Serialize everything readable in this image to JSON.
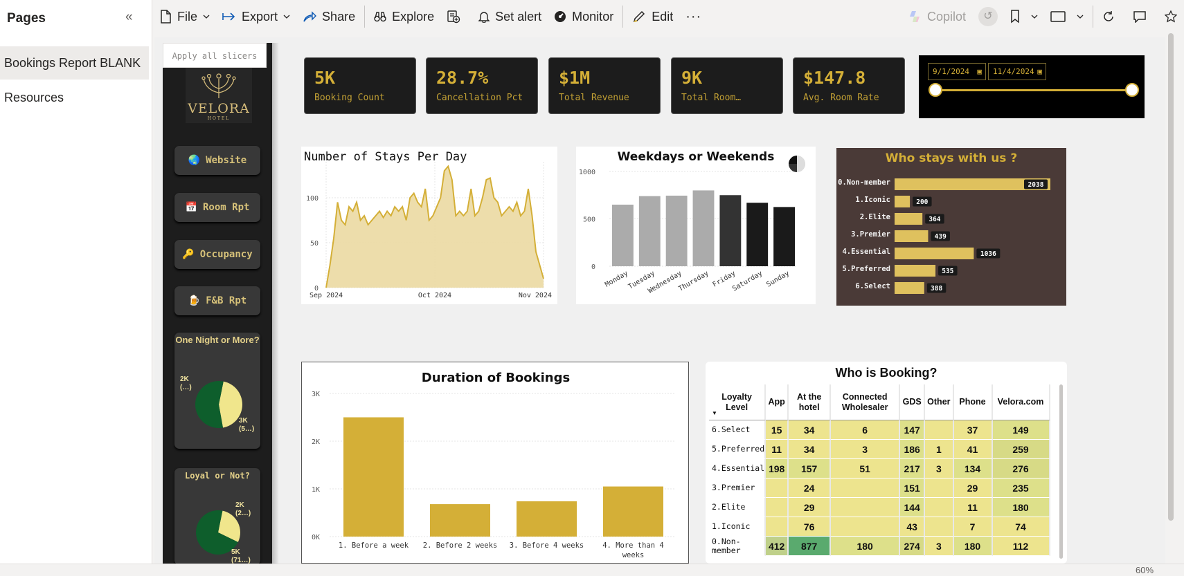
{
  "pages_pane": {
    "title": "Pages",
    "items": [
      {
        "label": "Bookings Report BLANK",
        "active": true
      },
      {
        "label": "Resources",
        "active": false
      }
    ]
  },
  "toolbar": {
    "file": "File",
    "export": "Export",
    "share": "Share",
    "explore": "Explore",
    "set_alert": "Set alert",
    "monitor": "Monitor",
    "edit": "Edit",
    "copilot": "Copilot"
  },
  "nav": {
    "apply_slicers": "Apply all slicers",
    "logo_word": "VELORA",
    "logo_sub": "HOTEL",
    "buttons": [
      {
        "icon": "🌏",
        "label": "Website"
      },
      {
        "icon": "📅",
        "label": "Room Rpt"
      },
      {
        "icon": "🔑",
        "label": "Occupancy"
      },
      {
        "icon": "🍺",
        "label": "F&B Rpt"
      }
    ],
    "one_night": {
      "title": "One Night or More?",
      "labels": [
        "2K (…)",
        "3K (5…)"
      ],
      "values": [
        0.44,
        0.56
      ]
    },
    "loyal": {
      "title": "Loyal or Not?",
      "labels": [
        "2K (2…)",
        "5K (71…)"
      ],
      "values": [
        0.29,
        0.71
      ]
    }
  },
  "kpis": [
    {
      "value": "5K",
      "label": "Booking Count"
    },
    {
      "value": "28.7%",
      "label": "Cancellation Pct"
    },
    {
      "value": "$1M",
      "label": "Total Revenue"
    },
    {
      "value": "9K",
      "label": "Total Room…"
    },
    {
      "value": "$147.8",
      "label": "Avg. Room Rate"
    }
  ],
  "date_slicer": {
    "start": "9/1/2024",
    "end": "11/4/2024"
  },
  "colors": {
    "gold": "#d4af37",
    "dark_green": "#0e5e2c",
    "light_yellow": "#f0e68c",
    "dark": "#1d1d1d"
  },
  "chart_data": [
    {
      "type": "area",
      "title": "Number of Stays Per Day",
      "x_ticks": [
        "Sep 2024",
        "Oct 2024",
        "Nov 2024"
      ],
      "y_ticks": [
        "0",
        "50",
        "100"
      ],
      "ylim": [
        0,
        140
      ],
      "values": [
        0,
        25,
        55,
        95,
        75,
        70,
        90,
        85,
        95,
        75,
        80,
        70,
        75,
        80,
        85,
        78,
        85,
        80,
        90,
        85,
        90,
        75,
        100,
        105,
        95,
        90,
        110,
        75,
        80,
        90,
        100,
        130,
        135,
        120,
        80,
        85,
        80,
        85,
        110,
        80,
        85,
        100,
        120,
        122,
        100,
        95,
        80,
        85,
        90,
        85,
        95,
        80,
        85,
        110,
        80,
        40,
        25,
        10
      ],
      "color": "#d4af37"
    },
    {
      "type": "bar",
      "title": "Weekdays or Weekends",
      "categories": [
        "Monday",
        "Tuesday",
        "Wednesday",
        "Thursday",
        "Friday",
        "Saturday",
        "Sunday"
      ],
      "values": [
        650,
        740,
        745,
        800,
        750,
        670,
        625
      ],
      "y_ticks": [
        "0",
        "500",
        "1000"
      ],
      "ylim": [
        0,
        1000
      ]
    },
    {
      "type": "bar",
      "title": "Who stays with us ?",
      "categories": [
        "0.Non-member",
        "1.Iconic",
        "2.Elite",
        "3.Premier",
        "4.Essential",
        "5.Preferred",
        "6.Select"
      ],
      "values": [
        2038,
        200,
        364,
        439,
        1036,
        535,
        388
      ],
      "labels": [
        "2038",
        "200",
        "364",
        "439",
        "1036",
        "535",
        "388"
      ]
    },
    {
      "type": "bar",
      "title": "Duration of Bookings",
      "categories": [
        "1. Before a week",
        "2. Before 2 weeks",
        "3. Before 4 weeks",
        "4. More than 4 weeks"
      ],
      "values": [
        2500,
        680,
        740,
        1050
      ],
      "y_ticks": [
        "0K",
        "1K",
        "2K",
        "3K"
      ],
      "ylim": [
        0,
        3000
      ]
    },
    {
      "type": "table",
      "title": "Who is Booking?",
      "corner": "Loyalty Level",
      "columns": [
        "App",
        "At the hotel",
        "Connected Wholesaler",
        "GDS",
        "Other",
        "Phone",
        "Velora.com"
      ],
      "rows": [
        {
          "label": "6.Select",
          "cells": [
            "15",
            "34",
            "6",
            "147",
            "",
            "37",
            "149"
          ]
        },
        {
          "label": "5.Preferred",
          "cells": [
            "11",
            "34",
            "3",
            "186",
            "1",
            "41",
            "259"
          ]
        },
        {
          "label": "4.Essential",
          "cells": [
            "198",
            "157",
            "51",
            "217",
            "3",
            "134",
            "276"
          ]
        },
        {
          "label": "3.Premier",
          "cells": [
            "",
            "24",
            "",
            "151",
            "",
            "29",
            "235"
          ]
        },
        {
          "label": "2.Elite",
          "cells": [
            "",
            "29",
            "",
            "144",
            "",
            "11",
            "180"
          ]
        },
        {
          "label": "1.Iconic",
          "cells": [
            "",
            "76",
            "",
            "43",
            "",
            "7",
            "74"
          ]
        },
        {
          "label": "0.Non-member",
          "cells": [
            "412",
            "877",
            "180",
            "274",
            "3",
            "180",
            "112"
          ]
        }
      ]
    }
  ],
  "statusbar": {
    "zoom": "60%"
  }
}
